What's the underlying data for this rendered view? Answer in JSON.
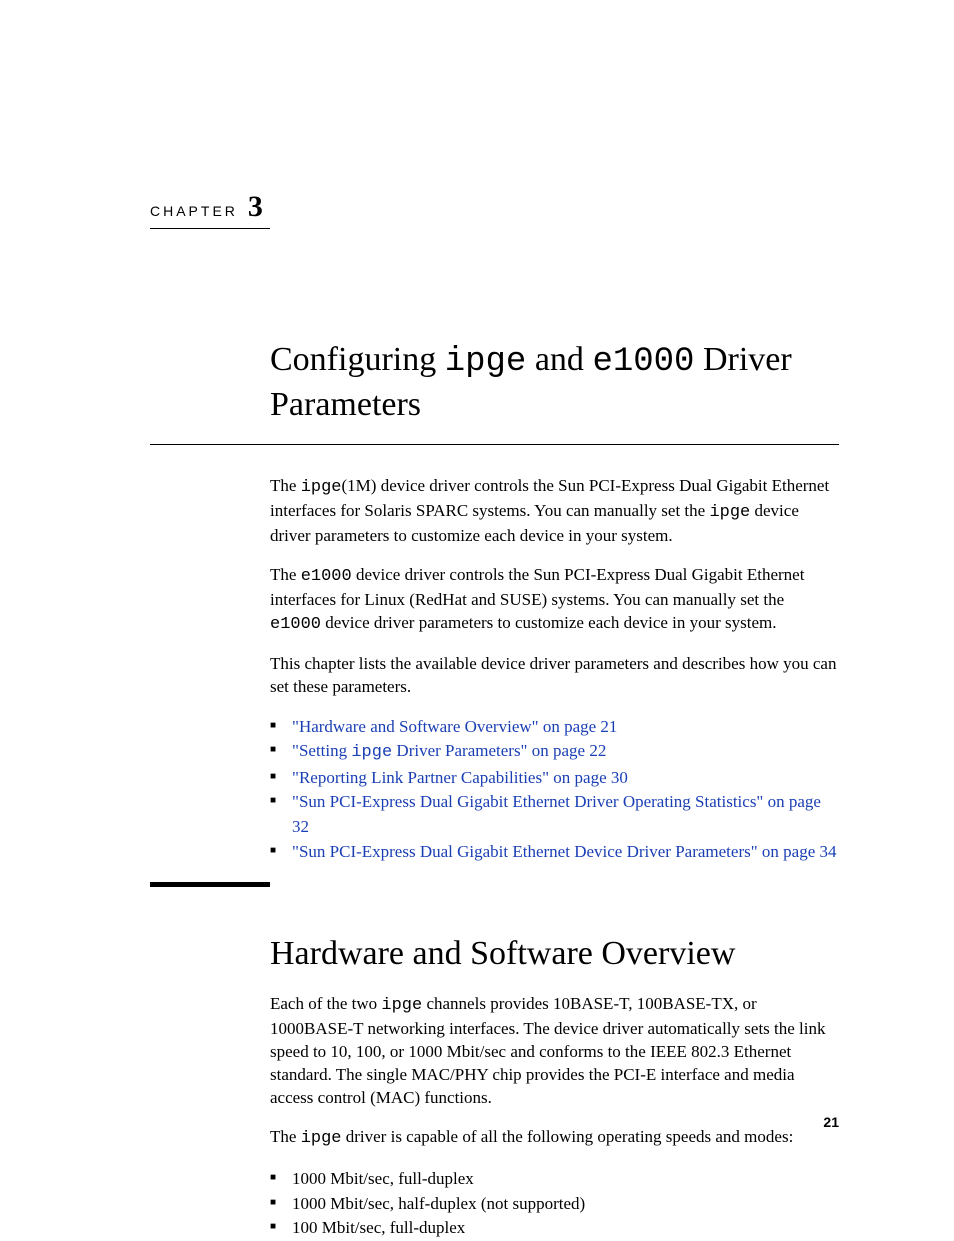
{
  "chapter": {
    "label": "CHAPTER",
    "number": "3"
  },
  "title": {
    "pre": "Configuring ",
    "code1": "ipge",
    "mid": " and ",
    "code2": "e1000",
    "post": " Driver Parameters"
  },
  "para1": {
    "a": "The ",
    "code1": "ipge",
    "b": "(1M) device driver controls the Sun PCI-Express Dual Gigabit Ethernet interfaces for Solaris SPARC systems. You can manually set the ",
    "code2": "ipge",
    "c": " device driver parameters to customize each device in your system."
  },
  "para2": {
    "a": "The ",
    "code1": "e1000",
    "b": " device driver controls the Sun PCI-Express Dual Gigabit Ethernet interfaces for Linux (RedHat and SUSE) systems. You can manually set the ",
    "code2": "e1000",
    "c": " device driver parameters to customize each device in your system."
  },
  "para3": "This chapter lists the available device driver parameters and describes how you can set these parameters.",
  "toc_links": [
    {
      "text": "\"Hardware and Software Overview\" on page 21"
    },
    {
      "pre": "\"Setting ",
      "code": "ipge",
      "post": " Driver Parameters\" on page 22"
    },
    {
      "text": "\"Reporting Link Partner Capabilities\" on page 30"
    },
    {
      "text": "\"Sun PCI-Express Dual Gigabit Ethernet Driver Operating Statistics\" on page 32"
    },
    {
      "text": "\"Sun PCI-Express Dual Gigabit Ethernet Device Driver Parameters\" on page 34"
    }
  ],
  "section_heading": "Hardware and Software Overview",
  "section_para1": {
    "a": "Each of the two ",
    "code1": "ipge",
    "b": " channels provides 10BASE-T, 100BASE-TX, or 1000BASE-T networking interfaces. The device driver automatically sets the link speed to 10, 100, or 1000 Mbit/sec and conforms to the IEEE 802.3 Ethernet standard. The single MAC/PHY chip provides the PCI-E interface and media access control (MAC) functions."
  },
  "section_para2": {
    "a": "The ",
    "code1": "ipge",
    "b": " driver is capable of all the following operating speeds and modes:"
  },
  "modes": [
    "1000 Mbit/sec, full-duplex",
    "1000 Mbit/sec, half-duplex (not supported)",
    "100 Mbit/sec, full-duplex"
  ],
  "page_number": "21"
}
